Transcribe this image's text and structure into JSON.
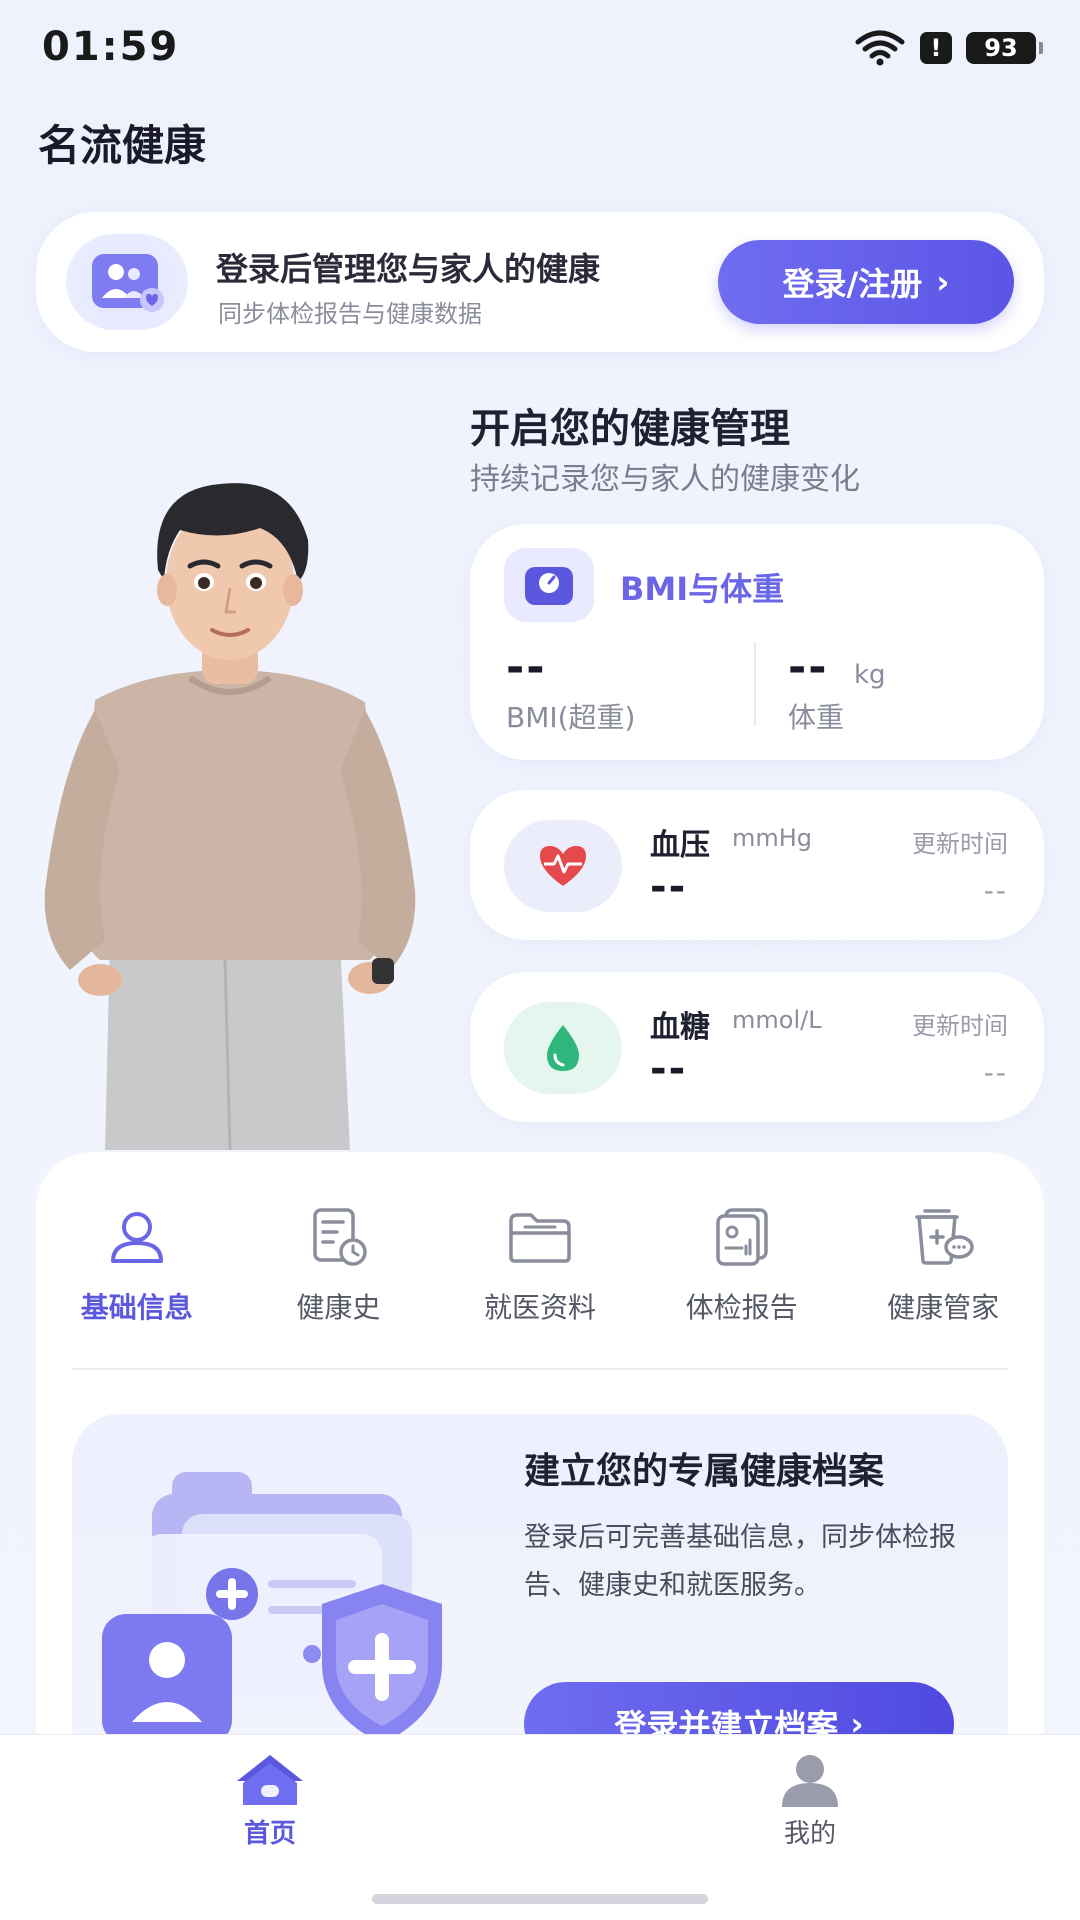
{
  "status_bar": {
    "time": "01:59",
    "battery": "93",
    "alert": "!"
  },
  "app": {
    "title": "名流健康"
  },
  "login_card": {
    "title": "登录后管理您与家人的健康",
    "subtitle": "同步体检报告与健康数据",
    "button_label": "登录/注册",
    "button_arrow": "›",
    "icon": "family-heart-icon"
  },
  "health": {
    "heading": "开启您的健康管理",
    "subheading": "持续记录您与家人的健康变化"
  },
  "bmi_card": {
    "title": "BMI与体重",
    "icon": "scale-icon",
    "bmi_value": "--",
    "bmi_label": "BMI(超重)",
    "weight_value": "--",
    "weight_unit": "kg",
    "weight_label": "体重"
  },
  "blood_pressure": {
    "name": "血压",
    "unit": "mmHg",
    "value": "--",
    "update_label": "更新时间",
    "update_value": "--",
    "icon": "heart-pulse-icon"
  },
  "blood_glucose": {
    "name": "血糖",
    "unit": "mmol/L",
    "value": "--",
    "update_label": "更新时间",
    "update_value": "--",
    "icon": "water-drop-icon"
  },
  "tabs": [
    {
      "label": "基础信息",
      "icon": "person-icon",
      "active": true
    },
    {
      "label": "健康史",
      "icon": "history-clipboard-icon",
      "active": false
    },
    {
      "label": "就医资料",
      "icon": "folder-icon",
      "active": false
    },
    {
      "label": "体检报告",
      "icon": "report-icon",
      "active": false
    },
    {
      "label": "健康管家",
      "icon": "steward-chat-icon",
      "active": false
    }
  ],
  "archive": {
    "title": "建立您的专属健康档案",
    "description": "登录后可完善基础信息，同步体检报告、健康史和就医服务。",
    "button_label": "登录并建立档案",
    "button_arrow": "›"
  },
  "bottom_nav": {
    "home_label": "首页",
    "me_label": "我的"
  },
  "colors": {
    "accent": "#5b57df",
    "background": "#eef2fd",
    "glucose_green": "#2fb67c",
    "heart_red": "#e5484d"
  }
}
